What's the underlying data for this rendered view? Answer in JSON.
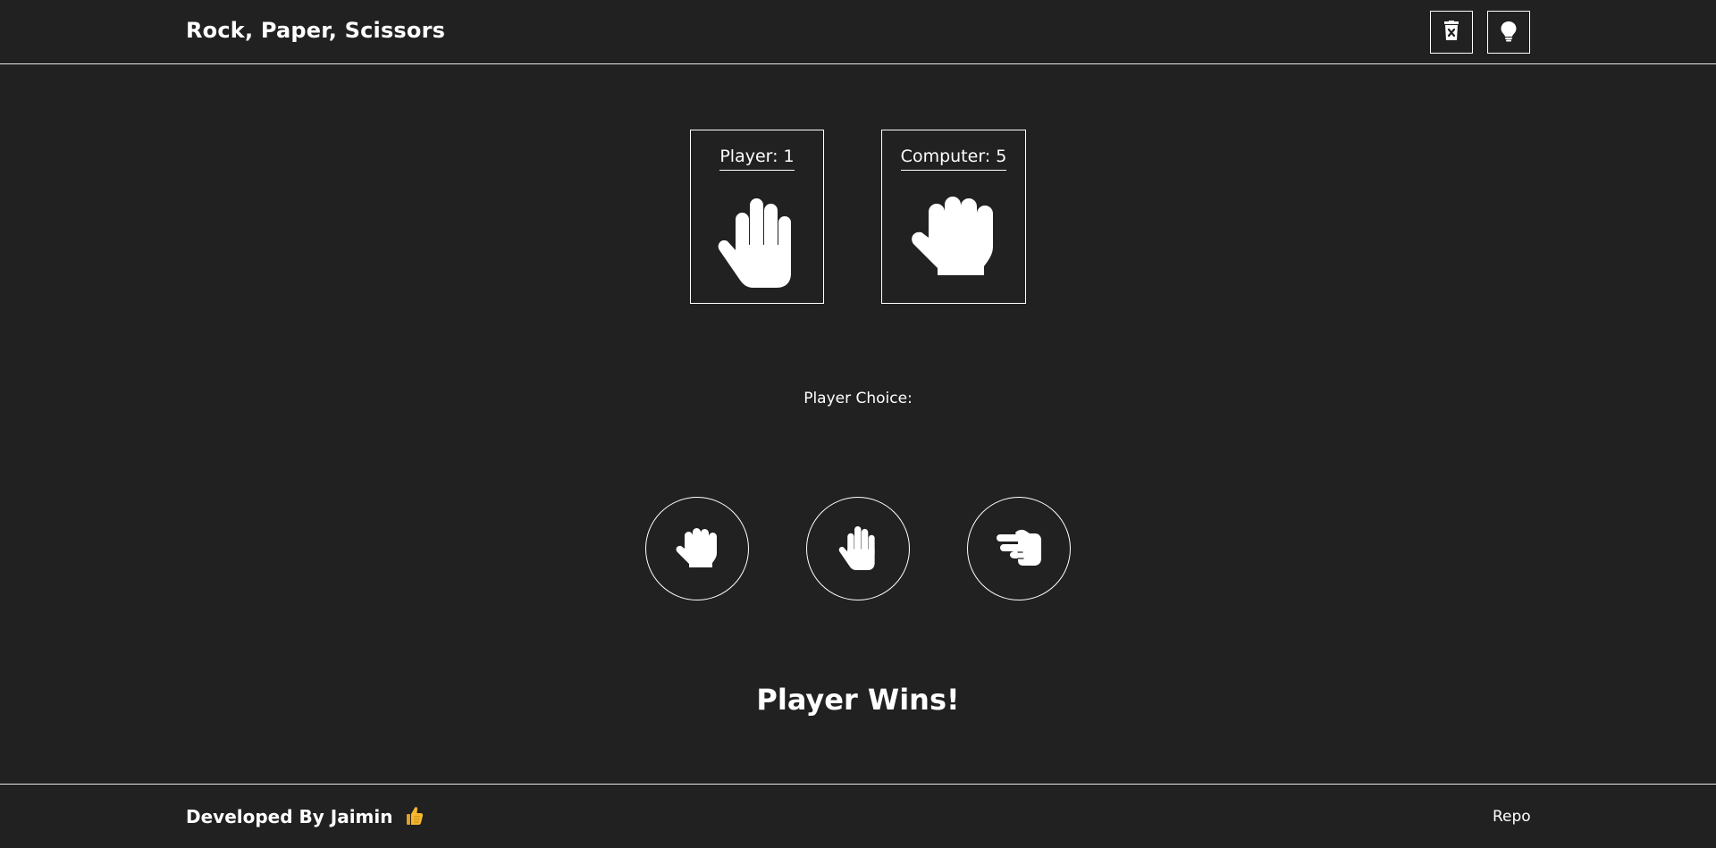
{
  "header": {
    "title": "Rock, Paper, Scissors",
    "reset_icon": "trash-x-icon",
    "hint_icon": "lightbulb-icon"
  },
  "scores": {
    "player_label": "Player: 1",
    "computer_label": "Computer: 5",
    "player_choice_icon": "hand-paper-icon",
    "computer_choice_icon": "hand-rock-icon"
  },
  "choices": {
    "label": "Player Choice:",
    "options": [
      {
        "name": "rock",
        "icon": "hand-rock-icon"
      },
      {
        "name": "paper",
        "icon": "hand-paper-icon"
      },
      {
        "name": "scissors",
        "icon": "hand-scissors-icon"
      }
    ]
  },
  "result": {
    "text": "Player Wins!"
  },
  "footer": {
    "credit": "Developed By Jaimin",
    "credit_icon": "thumbs-up-icon",
    "repo_link": "Repo"
  },
  "colors": {
    "background": "#212121",
    "foreground": "#ffffff",
    "thumb": "#f5b82e"
  }
}
